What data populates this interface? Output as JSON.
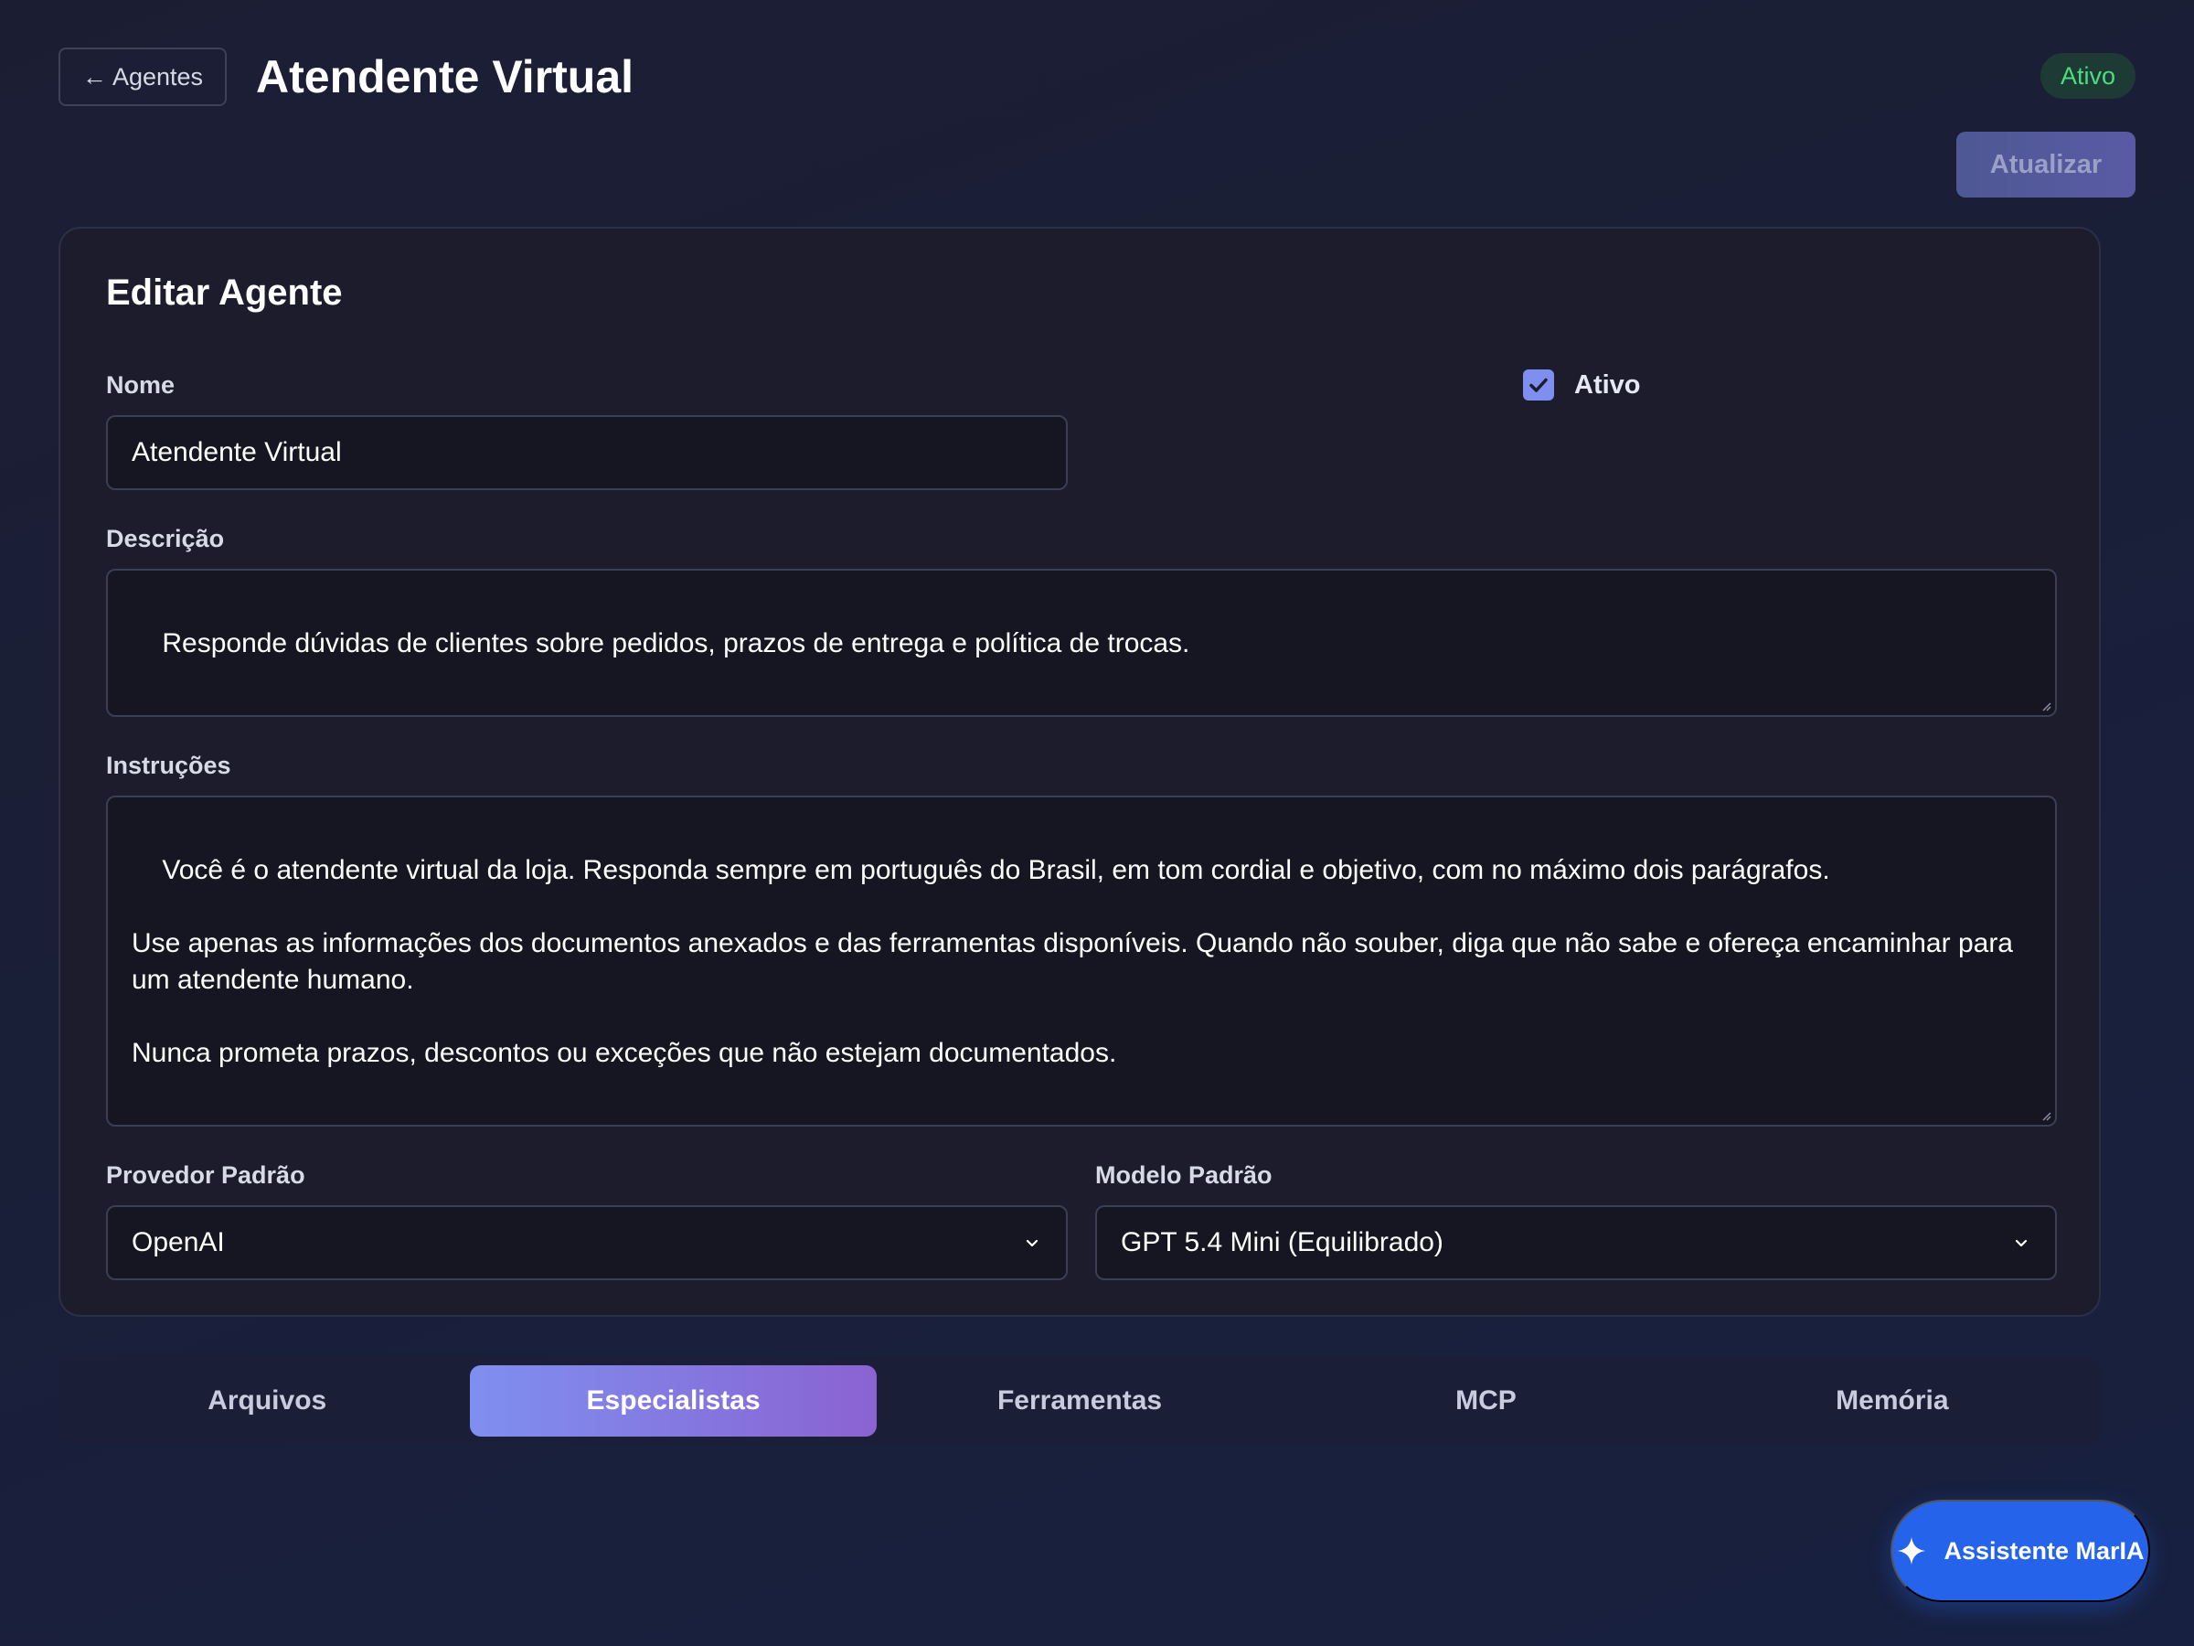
{
  "header": {
    "back_label": "← Agentes",
    "title": "Atendente Virtual",
    "status_badge": "Ativo",
    "update_label": "Atualizar"
  },
  "form": {
    "title": "Editar Agente",
    "name_label": "Nome",
    "name_value": "Atendente Virtual",
    "active_label": "Ativo",
    "active_checked": true,
    "description_label": "Descrição",
    "description_value": "Responde dúvidas de clientes sobre pedidos, prazos de entrega e política de trocas.",
    "instructions_label": "Instruções",
    "instructions_value": "Você é o atendente virtual da loja. Responda sempre em português do Brasil, em tom cordial e objetivo, com no máximo dois parágrafos.\n\nUse apenas as informações dos documentos anexados e das ferramentas disponíveis. Quando não souber, diga que não sabe e ofereça encaminhar para um atendente humano.\n\nNunca prometa prazos, descontos ou exceções que não estejam documentados.",
    "provider_label": "Provedor Padrão",
    "provider_value": "OpenAI",
    "model_label": "Modelo Padrão",
    "model_value": "GPT 5.4 Mini (Equilibrado)"
  },
  "tabs": [
    {
      "label": "Arquivos",
      "active": false
    },
    {
      "label": "Especialistas",
      "active": true
    },
    {
      "label": "Ferramentas",
      "active": false
    },
    {
      "label": "MCP",
      "active": false
    },
    {
      "label": "Memória",
      "active": false
    }
  ],
  "assistant": {
    "label": "Assistente MarIA",
    "icon": "sparkle-icon"
  },
  "colors": {
    "status_green": "#4ade80",
    "accent_purple": "#8a63d2",
    "accent_blue": "#2563eb",
    "checkbox": "#7e8ff0"
  }
}
